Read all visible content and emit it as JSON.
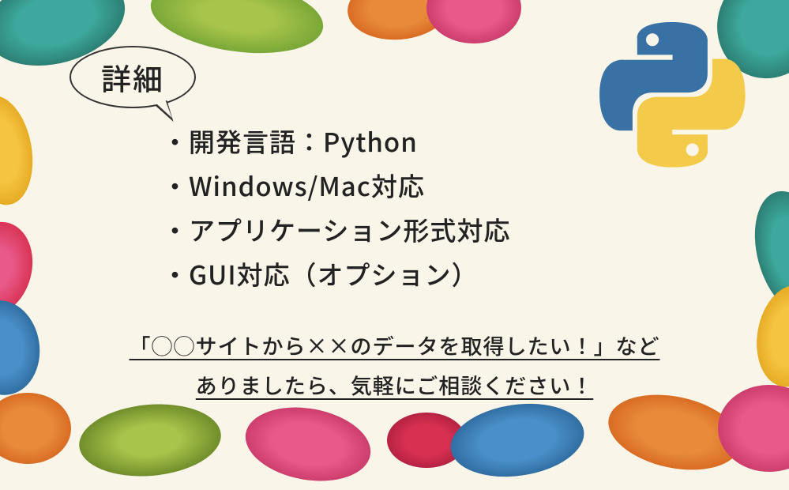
{
  "title": "詳細",
  "bullets": [
    "・開発言語：Python",
    "・Windows/Mac対応",
    "・アプリケーション形式対応",
    "・GUI対応（オプション）"
  ],
  "footer": {
    "line1": "「◯◯サイトから××のデータを取得したい！」など",
    "line2": "ありましたら、気軽にご相談ください！"
  },
  "logo": "python-logo"
}
